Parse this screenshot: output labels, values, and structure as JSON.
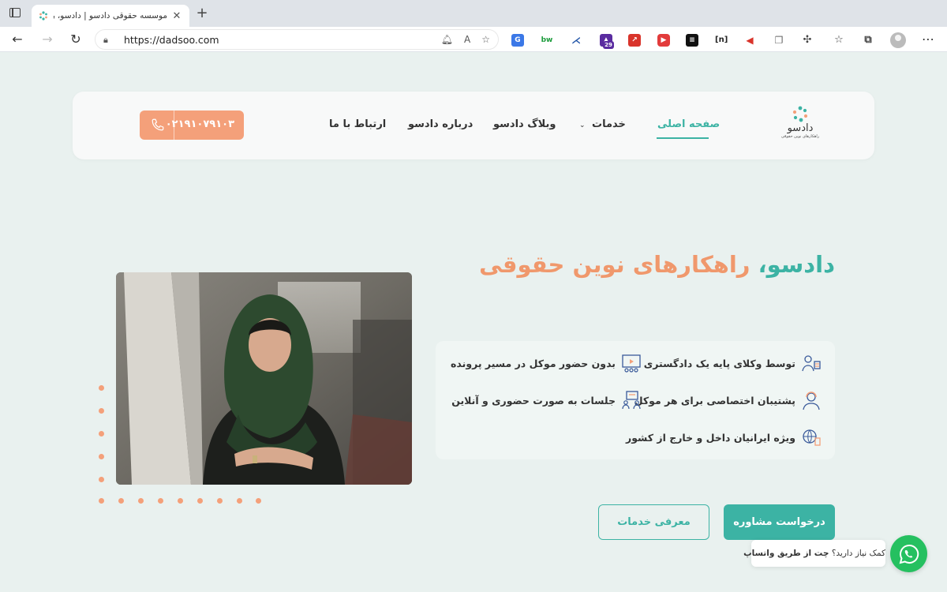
{
  "browser": {
    "tab_title": "موسسه حقوقی دادسو | دادسو، راهکارهای نوین حقوقی",
    "url": "https://dadsoo.com",
    "extension_badge": "29",
    "extensions": [
      "translate-icon",
      "bw-icon",
      "tool-icon",
      "grad-icon",
      "arrow-icon",
      "play-icon",
      "wallet-icon",
      "brackets-icon",
      "megaphone-icon",
      "copy-icon",
      "puzzle-icon"
    ]
  },
  "header": {
    "logo_name": "دادسو",
    "logo_tagline": "راهکارهای نوین حقوقی",
    "nav": {
      "home": "صفحه اصلی",
      "services": "خدمات",
      "blog": "وبلاگ دادسو",
      "about": "درباره دادسو",
      "contact": "ارتباط با ما"
    },
    "phone": "۰۲۱۹۱۰۷۹۱۰۳"
  },
  "hero": {
    "brand": "دادسو،",
    "title_rest": " راهکارهای نوین حقوقی",
    "features": [
      "توسط وکلای پایه یک دادگستری",
      "بدون حضور موکل در مسیر پرونده",
      "پشتیبان اختصاصی برای هر موکل",
      "جلسات به صورت حضوری و آنلاین",
      "ویژه ایرانیان داخل و خارج از کشور"
    ],
    "primary_button": "درخواست مشاوره",
    "secondary_button": "معرفی خدمات"
  },
  "whatsapp": {
    "prompt": "کمک نیاز دارید؟",
    "cta": "چت از طریق واتساپ"
  },
  "colors": {
    "teal": "#3cb3a4",
    "orange": "#f4a07a",
    "background": "#e9f1ef",
    "whatsapp": "#25c060"
  }
}
